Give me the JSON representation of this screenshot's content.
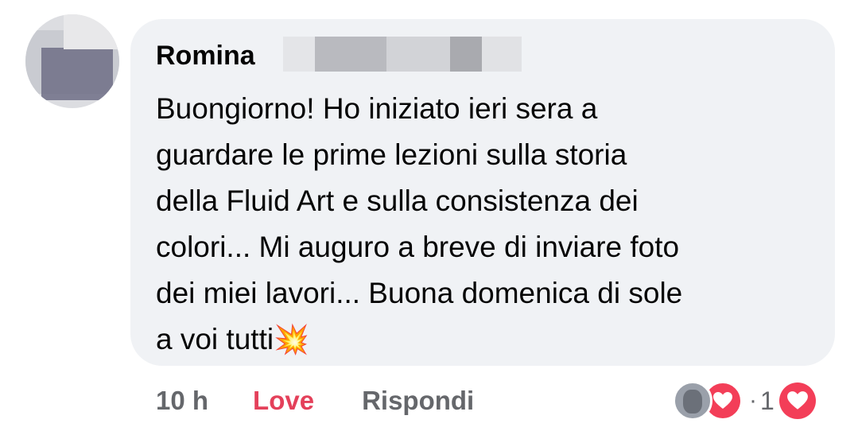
{
  "comment": {
    "author": "Romina",
    "text": "Buongiorno! Ho iniziato ieri sera a\nguardare le prime lezioni sulla storia\ndella Fluid Art e sulla consistenza dei\ncolori... Mi auguro a breve di inviare foto\ndei miei lavori... Buona domenica di sole\na voi tutti",
    "emoji": "💥"
  },
  "actions": {
    "time": "10 h",
    "love_label": "Love",
    "reply_label": "Rispondi"
  },
  "reactions": {
    "separator": "·",
    "count": "1",
    "type_icon": "heart-icon"
  },
  "colors": {
    "bubble": "#f0f2f5",
    "love": "#e4405a",
    "heart": "#f33e58",
    "muted": "#65676b"
  }
}
